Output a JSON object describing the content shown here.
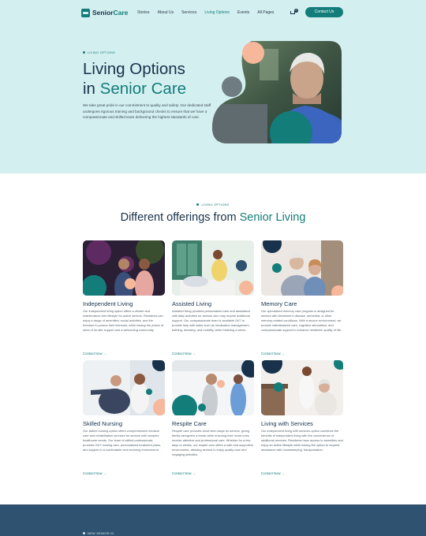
{
  "brand": {
    "name_part1": "Senior",
    "name_part2": "Care"
  },
  "nav": {
    "items": [
      "Stories",
      "About Us",
      "Services",
      "Living Options",
      "Events",
      "All Pages"
    ],
    "active_index": 3,
    "cart_count": "0",
    "contact_label": "Contact Us"
  },
  "hero": {
    "eyebrow": "LIVING OPTIONS",
    "title_line1": "Living Options",
    "title_in": "in",
    "title_accent": "Senior Care",
    "description": "We take great pride in our commitment to quality and safety. Our dedicated staff undergoes rigorous training and background checks to ensure that we have a compassionate and skilled team delivering the highest standards of care."
  },
  "offerings": {
    "eyebrow": "LIVING OPTIONS",
    "title_plain": "Different offerings from",
    "title_accent": "Senior Living",
    "cards": [
      {
        "title": "Independent Living",
        "text": "Our independent living option offers a vibrant and maintenance-free lifestyle for active seniors. Residents can enjoy a range of amenities, social activities, and the freedom to pursue their interests, while having the peace of mind of on-site support and a welcoming community.",
        "link": "Contact Now"
      },
      {
        "title": "Assisted Living",
        "text": "Assisted living provides personalized care and assistance with daily activities for seniors who may require additional support. Our compassionate team is available 24/7 to provide help with tasks such as medication management, bathing, dressing, and mobility, while fostering a warm.",
        "link": "Contact Now"
      },
      {
        "title": "Memory Care",
        "text": "Our specialized memory care program is designed for seniors with Alzheimer's disease, dementia, or other memory-related conditions. With a secure environment, we provide individualized care, cognitive stimulation, and compassionate support to enhance residents' quality of life.",
        "link": "Contact Now"
      },
      {
        "title": "Skilled Nursing",
        "text": "Our skilled nursing option offers comprehensive medical care and rehabilitation services for seniors with complex healthcare needs. Our team of skilled professionals provides 24/7 nursing care, personalized treatment plans, and support in a comfortable and nurturing environment.",
        "link": "Contact Now"
      },
      {
        "title": "Respite Care",
        "text": "Respite care provides short-term stays for seniors, giving family caregivers a break while ensuring their loved ones receive attentive and professional care. Whether for a few days or weeks, our respite care offers a safe and supportive environment, allowing seniors to enjoy quality care and engaging activities.",
        "link": "Contact Now"
      },
      {
        "title": "Living with Services",
        "text": "Our independent living with services option combines the benefits of independent living with the convenience of additional services. Residents have access to amenities and enjoy an active lifestyle while having the option to request assistance with housekeeping, transportation.",
        "link": "Contact Now"
      }
    ]
  },
  "footer": {
    "eyebrow": "NEW SENIOR ID"
  },
  "colors": {
    "accent": "#137d7a",
    "navy": "#17324a",
    "hero_bg": "#d4eff0",
    "peach": "#f6b79b",
    "footer_bg": "#2e5270"
  }
}
